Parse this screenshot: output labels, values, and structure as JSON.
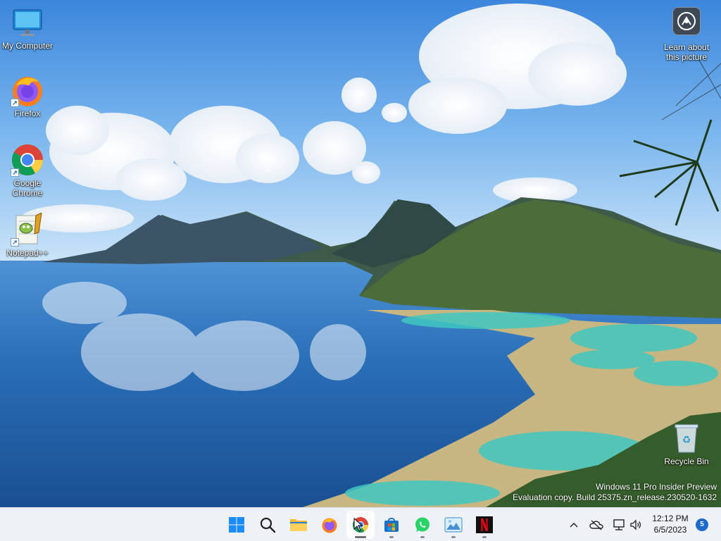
{
  "desktop": {
    "icons": [
      {
        "label": "My Computer",
        "icon": "monitor-icon"
      },
      {
        "label": "Firefox",
        "icon": "firefox-icon"
      },
      {
        "label": "Google Chrome",
        "icon": "chrome-icon"
      },
      {
        "label": "Notepad++",
        "icon": "notepadpp-icon"
      }
    ],
    "learn_about": {
      "label": "Learn about this picture",
      "icon": "camera-icon"
    },
    "recycle_bin": {
      "label": "Recycle Bin",
      "icon": "recycle-bin-icon"
    },
    "watermark": {
      "line1": "Windows 11 Pro Insider Preview",
      "line2": "Evaluation copy. Build 25375.zn_release.230520-1632"
    }
  },
  "taskbar": {
    "apps": [
      {
        "name": "start",
        "icon": "windows-start-icon",
        "running": false
      },
      {
        "name": "search",
        "icon": "search-icon",
        "running": false
      },
      {
        "name": "file-explorer",
        "icon": "folder-icon",
        "running": false
      },
      {
        "name": "firefox",
        "icon": "firefox-icon",
        "running": false
      },
      {
        "name": "chrome",
        "icon": "chrome-icon",
        "running": true
      },
      {
        "name": "store",
        "icon": "store-icon",
        "running": true
      },
      {
        "name": "whatsapp",
        "icon": "whatsapp-icon",
        "running": true
      },
      {
        "name": "photos",
        "icon": "photos-icon",
        "running": true
      },
      {
        "name": "netflix",
        "icon": "netflix-icon",
        "running": true
      }
    ],
    "tray": {
      "icons": [
        "chevron-up-icon",
        "cloud-off-icon",
        "network-icon",
        "volume-icon"
      ],
      "time": "12:12 PM",
      "date": "6/5/2023",
      "notifications": "5"
    }
  },
  "colors": {
    "taskbar_bg": "#eef1f6",
    "accent": "#1b6ad0"
  }
}
